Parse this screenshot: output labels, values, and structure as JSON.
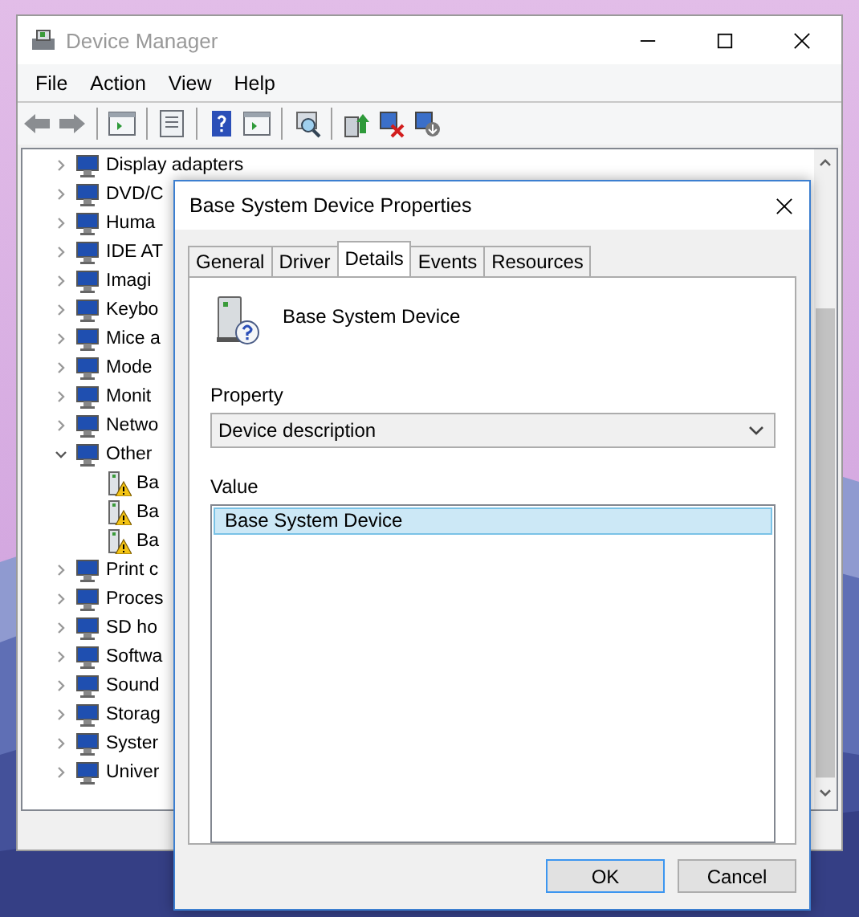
{
  "window": {
    "title": "Device Manager"
  },
  "menu": [
    "File",
    "Action",
    "View",
    "Help"
  ],
  "tree": [
    {
      "label": "Display adapters",
      "expanded": false
    },
    {
      "label": "DVD/C",
      "expanded": false
    },
    {
      "label": "Huma",
      "expanded": false
    },
    {
      "label": "IDE AT",
      "expanded": false
    },
    {
      "label": "Imagi",
      "expanded": false
    },
    {
      "label": "Keybo",
      "expanded": false
    },
    {
      "label": "Mice a",
      "expanded": false
    },
    {
      "label": "Mode",
      "expanded": false
    },
    {
      "label": "Monit",
      "expanded": false
    },
    {
      "label": "Netwo",
      "expanded": false
    },
    {
      "label": "Other",
      "expanded": true,
      "children": [
        {
          "label": "Ba"
        },
        {
          "label": "Ba"
        },
        {
          "label": "Ba"
        }
      ]
    },
    {
      "label": "Print c",
      "expanded": false
    },
    {
      "label": "Proces",
      "expanded": false
    },
    {
      "label": "SD ho",
      "expanded": false
    },
    {
      "label": "Softwa",
      "expanded": false
    },
    {
      "label": "Sound",
      "expanded": false
    },
    {
      "label": "Storag",
      "expanded": false
    },
    {
      "label": "Syster",
      "expanded": false
    },
    {
      "label": "Univer",
      "expanded": false
    }
  ],
  "dialog": {
    "title": "Base System Device Properties",
    "tabs": [
      {
        "label": "General",
        "selected": false
      },
      {
        "label": "Driver",
        "selected": false
      },
      {
        "label": "Details",
        "selected": true
      },
      {
        "label": "Events",
        "selected": false
      },
      {
        "label": "Resources",
        "selected": false
      }
    ],
    "device_name": "Base System Device",
    "property_label": "Property",
    "property_value": "Device description",
    "value_label": "Value",
    "values": [
      {
        "text": "Base System Device",
        "selected": true
      }
    ],
    "buttons": [
      {
        "label": "OK",
        "default": true
      },
      {
        "label": "Cancel",
        "default": false
      }
    ]
  }
}
